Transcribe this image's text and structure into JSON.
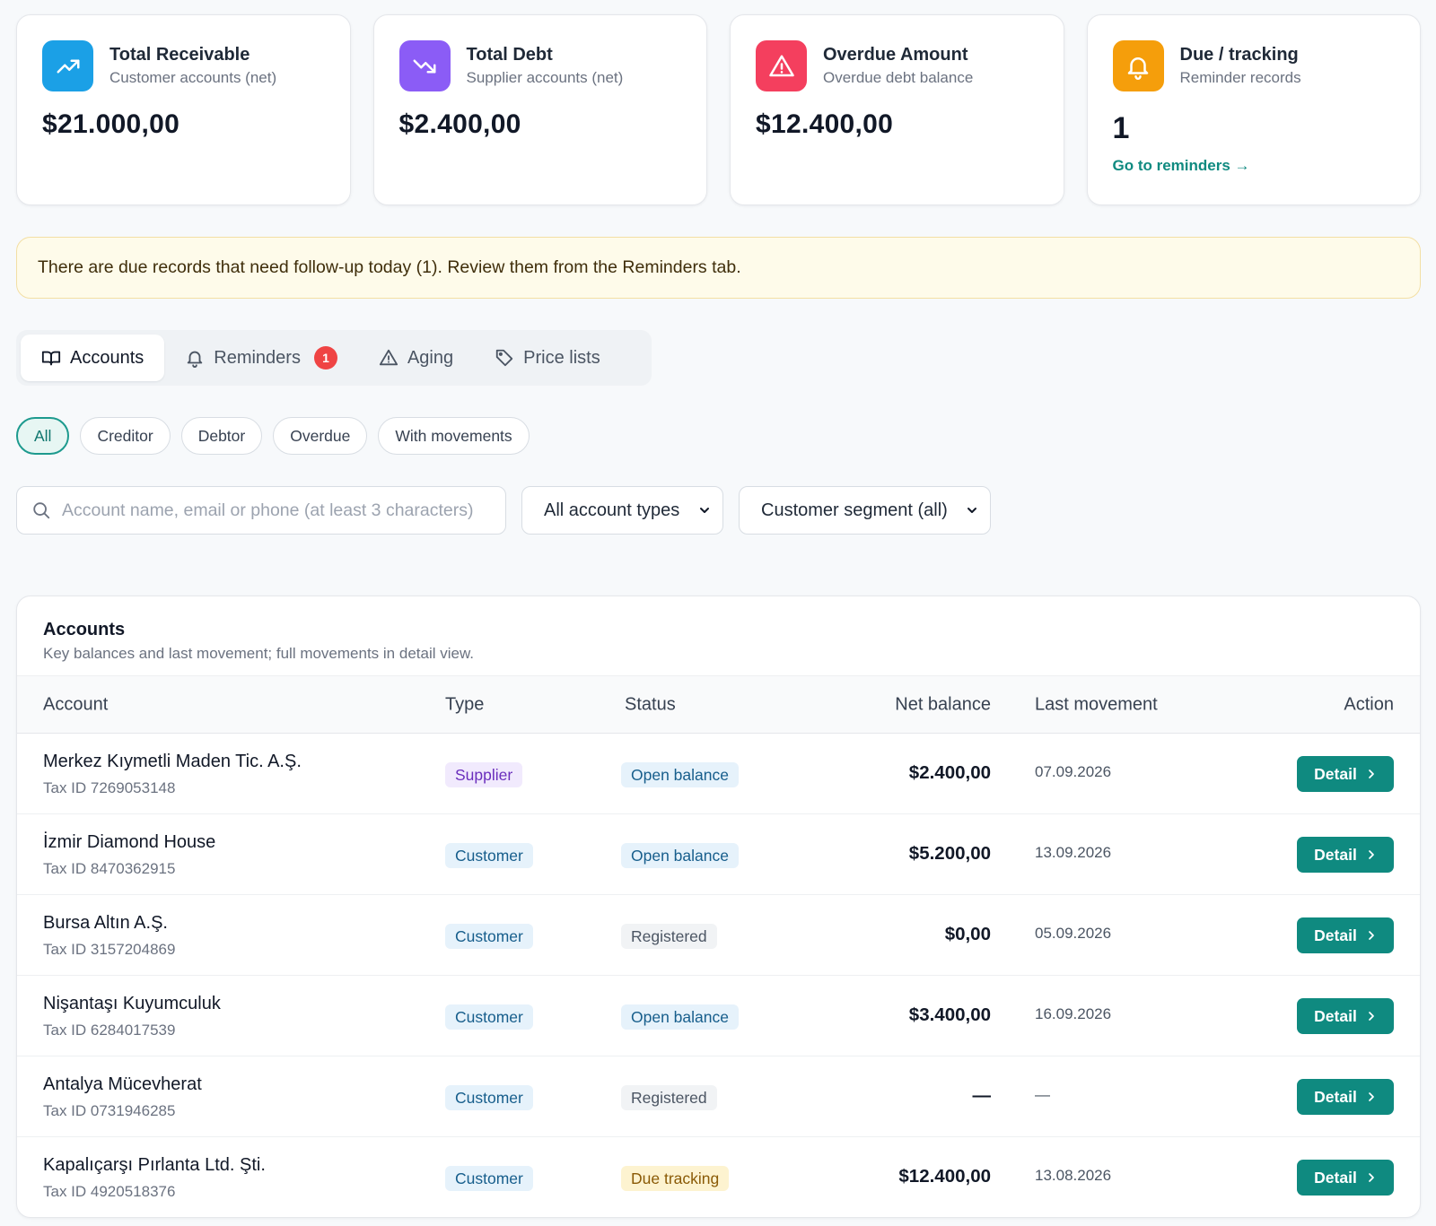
{
  "stats": [
    {
      "title": "Total Receivable",
      "subtitle": "Customer accounts (net)",
      "value": "$21.000,00",
      "icon": "trend-up-icon",
      "color": "#1ba0e6"
    },
    {
      "title": "Total Debt",
      "subtitle": "Supplier accounts (net)",
      "value": "$2.400,00",
      "icon": "trend-down-icon",
      "color": "#8b5cf6"
    },
    {
      "title": "Overdue Amount",
      "subtitle": "Overdue debt balance",
      "value": "$12.400,00",
      "icon": "warning-icon",
      "color": "#f43f5e"
    },
    {
      "title": "Due / tracking",
      "subtitle": "Reminder records",
      "value": "1",
      "icon": "bell-icon",
      "color": "#f59e0b",
      "link": "Go to reminders →"
    }
  ],
  "banner": "There are due records that need follow-up today (1). Review them from the Reminders tab.",
  "tabs": [
    {
      "label": "Accounts",
      "icon": "book-icon",
      "active": true
    },
    {
      "label": "Reminders",
      "icon": "bell-icon",
      "badge": "1"
    },
    {
      "label": "Aging",
      "icon": "warning-icon"
    },
    {
      "label": "Price lists",
      "icon": "tag-icon"
    }
  ],
  "filters": [
    "All",
    "Creditor",
    "Debtor",
    "Overdue",
    "With movements"
  ],
  "search": {
    "placeholder": "Account name, email or phone (at least 3 characters)"
  },
  "selects": {
    "account_type": "All account types",
    "segment": "Customer segment (all)"
  },
  "table": {
    "title": "Accounts",
    "description": "Key balances and last movement; full movements in detail view.",
    "columns": {
      "account": "Account",
      "type": "Type",
      "status": "Status",
      "net": "Net balance",
      "last": "Last movement",
      "action": "Action"
    },
    "action_label": "Detail",
    "rows": [
      {
        "name": "Merkez Kıymetli Maden Tic. A.Ş.",
        "tax": "Tax ID 7269053148",
        "type": "Supplier",
        "status": "Open balance",
        "net": "$2.400,00",
        "last": "07.09.2026"
      },
      {
        "name": "İzmir Diamond House",
        "tax": "Tax ID 8470362915",
        "type": "Customer",
        "status": "Open balance",
        "net": "$5.200,00",
        "last": "13.09.2026"
      },
      {
        "name": "Bursa Altın A.Ş.",
        "tax": "Tax ID 3157204869",
        "type": "Customer",
        "status": "Registered",
        "net": "$0,00",
        "last": "05.09.2026"
      },
      {
        "name": "Nişantaşı Kuyumculuk",
        "tax": "Tax ID 6284017539",
        "type": "Customer",
        "status": "Open balance",
        "net": "$3.400,00",
        "last": "16.09.2026"
      },
      {
        "name": "Antalya Mücevherat",
        "tax": "Tax ID 0731946285",
        "type": "Customer",
        "status": "Registered",
        "net": "—",
        "last": "—"
      },
      {
        "name": "Kapalıçarşı Pırlanta Ltd. Şti.",
        "tax": "Tax ID 4920518376",
        "type": "Customer",
        "status": "Due tracking",
        "net": "$12.400,00",
        "last": "13.08.2026"
      }
    ]
  }
}
